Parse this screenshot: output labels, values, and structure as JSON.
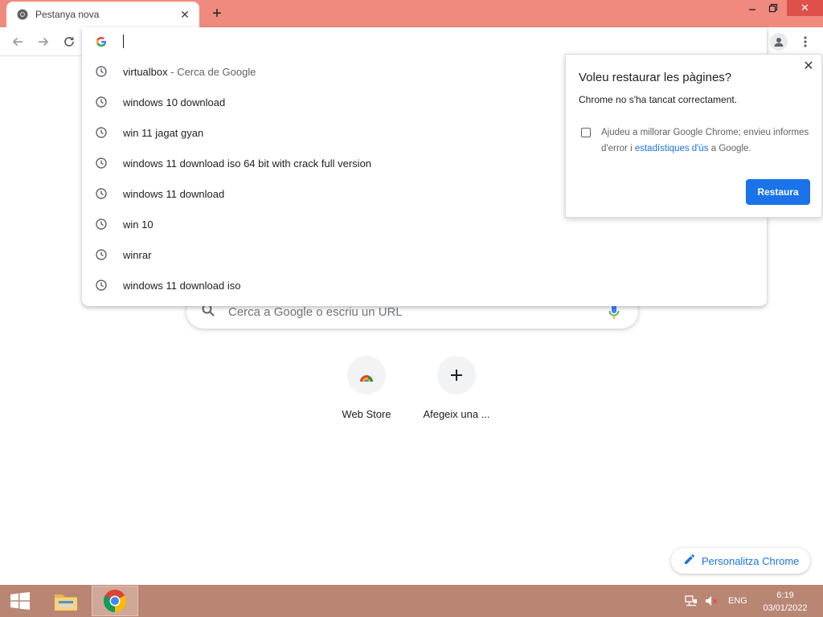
{
  "tab": {
    "title": "Pestanya nova",
    "favicon": "chrome-icon"
  },
  "omnibox": {
    "value": "",
    "suggestions": [
      {
        "text": "virtualbox",
        "suffix": " - Cerca de Google"
      },
      {
        "text": "windows 10 download",
        "suffix": ""
      },
      {
        "text": "win 11 jagat gyan",
        "suffix": ""
      },
      {
        "text": "windows 11 download iso 64 bit with crack full version",
        "suffix": ""
      },
      {
        "text": "windows 11 download",
        "suffix": ""
      },
      {
        "text": "win 10",
        "suffix": ""
      },
      {
        "text": "winrar",
        "suffix": ""
      },
      {
        "text": "windows 11 download iso",
        "suffix": ""
      }
    ]
  },
  "restore_bubble": {
    "title": "Voleu restaurar les pàgines?",
    "message": "Chrome no s'ha tancat correctament.",
    "option_text_1": "Ajudeu a millorar Google Chrome; envieu informes d'error i ",
    "option_link": "estadístiques d'ús",
    "option_text_2": " a Google.",
    "restore_label": "Restaura"
  },
  "ntp": {
    "search_placeholder": "Cerca a Google o escriu un URL",
    "shortcuts": [
      {
        "label": "Web Store",
        "icon": "webstore-icon"
      },
      {
        "label": "Afegeix una ...",
        "icon": "plus-icon"
      }
    ],
    "customize_label": "Personalitza Chrome"
  },
  "taskbar": {
    "language": "ENG",
    "time": "6:19",
    "date": "03/01/2022"
  },
  "colors": {
    "titlebar": "#f08a7e",
    "accent": "#1a73e8",
    "taskbar": "#b98674"
  }
}
